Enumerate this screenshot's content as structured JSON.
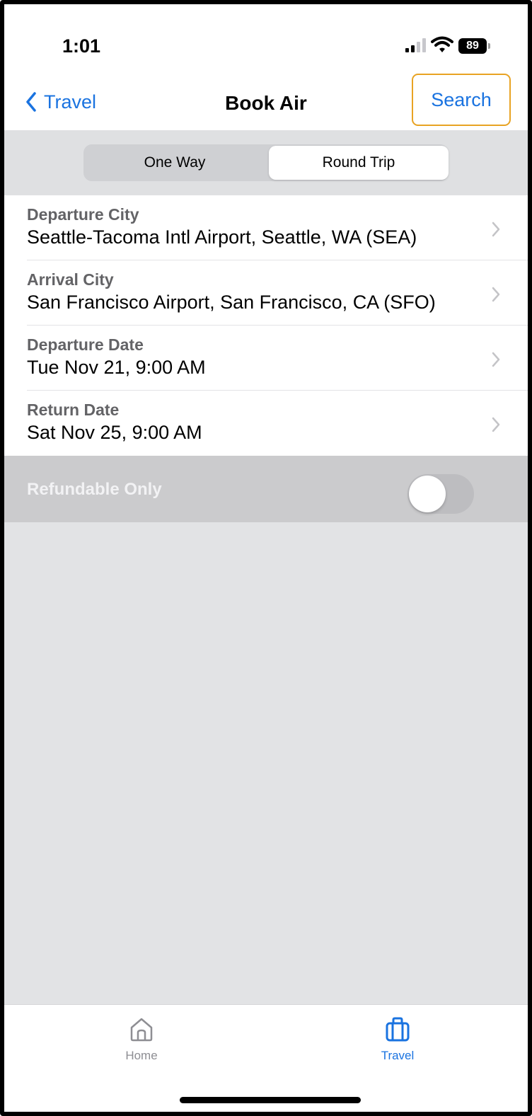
{
  "status_bar": {
    "time": "1:01",
    "battery": "89",
    "icons": [
      "cellular-signal-icon",
      "wifi-icon",
      "battery-icon"
    ]
  },
  "nav": {
    "back_label": "Travel",
    "title": "Book Air",
    "search_label": "Search",
    "accent_color": "#1a73e0",
    "highlight_color": "#e8a323"
  },
  "trip_type": {
    "options": [
      "One Way",
      "Round Trip"
    ],
    "selected": "Round Trip"
  },
  "fields": [
    {
      "label": "Departure City",
      "value": "Seattle-Tacoma Intl Airport, Seattle, WA (SEA)"
    },
    {
      "label": "Arrival City",
      "value": "San Francisco Airport, San Francisco, CA (SFO)"
    },
    {
      "label": "Departure Date",
      "value": "Tue Nov 21, 9:00 AM"
    },
    {
      "label": "Return Date",
      "value": "Sat Nov 25, 9:00 AM"
    }
  ],
  "refundable": {
    "label": "Refundable Only",
    "enabled": false
  },
  "tab_bar": {
    "home_label": "Home",
    "travel_label": "Travel",
    "active": "Travel"
  }
}
